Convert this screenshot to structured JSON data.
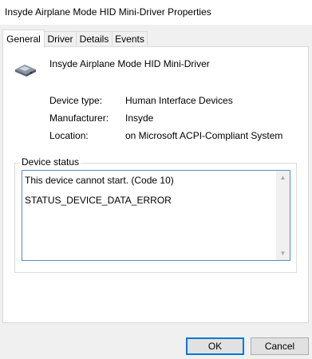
{
  "window": {
    "title": "Insyde Airplane Mode HID Mini-Driver Properties"
  },
  "tabs": [
    {
      "label": "General"
    },
    {
      "label": "Driver"
    },
    {
      "label": "Details"
    },
    {
      "label": "Events"
    }
  ],
  "device": {
    "name": "Insyde Airplane Mode HID Mini-Driver",
    "icon": "hid-device-icon",
    "properties": [
      {
        "label": "Device type:",
        "value": "Human Interface Devices"
      },
      {
        "label": "Manufacturer:",
        "value": "Insyde"
      },
      {
        "label": "Location:",
        "value": "on Microsoft ACPI-Compliant System"
      }
    ]
  },
  "status": {
    "group_label": "Device status",
    "line1": "This device cannot start. (Code 10)",
    "line2": "STATUS_DEVICE_DATA_ERROR"
  },
  "buttons": {
    "ok": "OK",
    "cancel": "Cancel"
  },
  "colors": {
    "accent": "#0078d7",
    "panel": "#ffffff",
    "chrome": "#f0f0f0"
  }
}
